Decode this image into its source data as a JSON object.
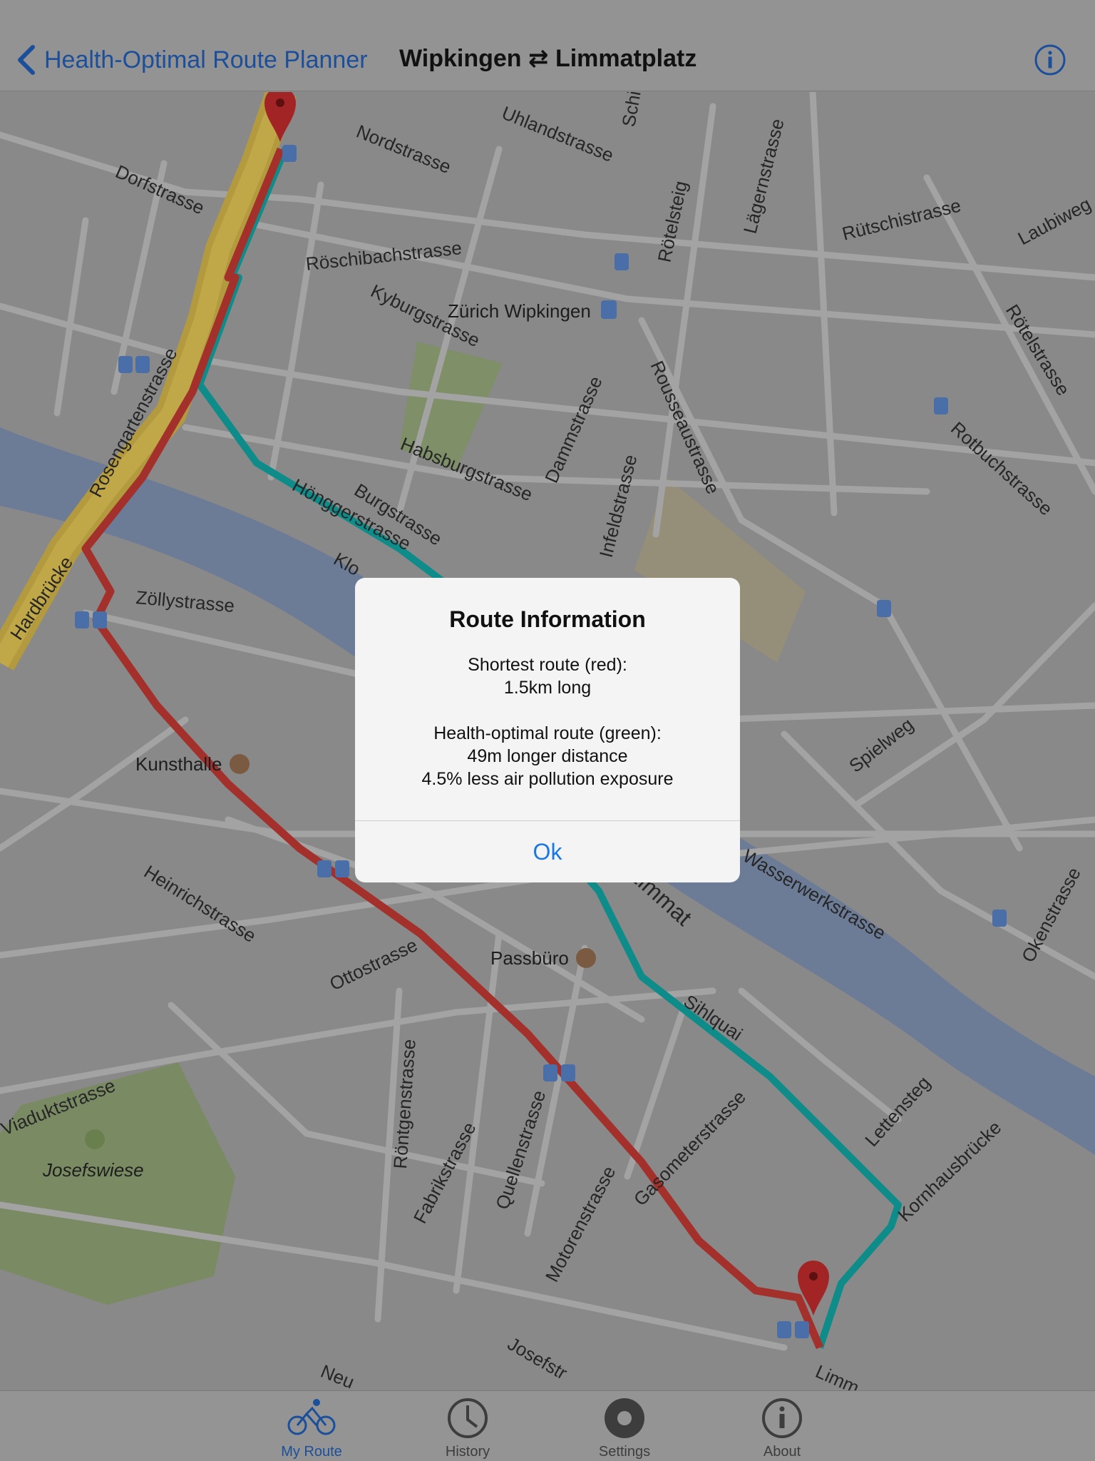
{
  "nav": {
    "back_label": "Health-Optimal Route Planner",
    "title": "Wipkingen ⇄ Limmatplatz",
    "info_icon": "info-circle-icon"
  },
  "map": {
    "streets": [
      "Dorfstrasse",
      "Nordstrasse",
      "Uhlandstrasse",
      "Röschibachstrasse",
      "Kyburgstrasse",
      "Rötelsteig",
      "Lägernstrasse",
      "Rütschistrasse",
      "Laubiweg",
      "Rötelstrasse",
      "Rosengartenstrasse",
      "Habsburgstrasse",
      "Dammstrasse",
      "Rousseaustrasse",
      "Burgstrasse",
      "Hönggerstrasse",
      "Rotbuchstrasse",
      "Hardbrücke",
      "Zöllystrasse",
      "Infeldstrasse",
      "Spielweg",
      "Heinrichstrasse",
      "Wasserwerkstrasse",
      "Ottostrasse",
      "Limmat",
      "Sihlquai",
      "Okenstrasse",
      "Viaduktstrasse",
      "Röntgenstrasse",
      "Fabrikstrasse",
      "Quellenstrasse",
      "Lettensteg",
      "Kornhausbrücke",
      "Motorenstrasse",
      "Gasometerstrasse",
      "Josefstr",
      "Neu",
      "Limm",
      "Schi",
      "Klo"
    ],
    "pois": [
      "Zürich Wipkingen",
      "Kunsthalle",
      "Passbüro",
      "Josefswiese"
    ],
    "route_colors": {
      "shortest": "#a3302a",
      "health_optimal": "#0e8c8a"
    }
  },
  "dialog": {
    "title": "Route Information",
    "line1": "Shortest route (red):",
    "line2": "1.5km long",
    "line3": "Health-optimal route (green):",
    "line4": "49m longer distance",
    "line5": "4.5% less air pollution exposure",
    "ok_label": "Ok"
  },
  "tabs": [
    {
      "label": "My Route",
      "icon": "bicycle-icon",
      "active": true
    },
    {
      "label": "History",
      "icon": "clock-icon",
      "active": false
    },
    {
      "label": "Settings",
      "icon": "gear-icon",
      "active": false
    },
    {
      "label": "About",
      "icon": "info-circle-icon",
      "active": false
    }
  ],
  "colors": {
    "accent": "#1a78e6",
    "nav_tint": "#1b4f9c"
  }
}
